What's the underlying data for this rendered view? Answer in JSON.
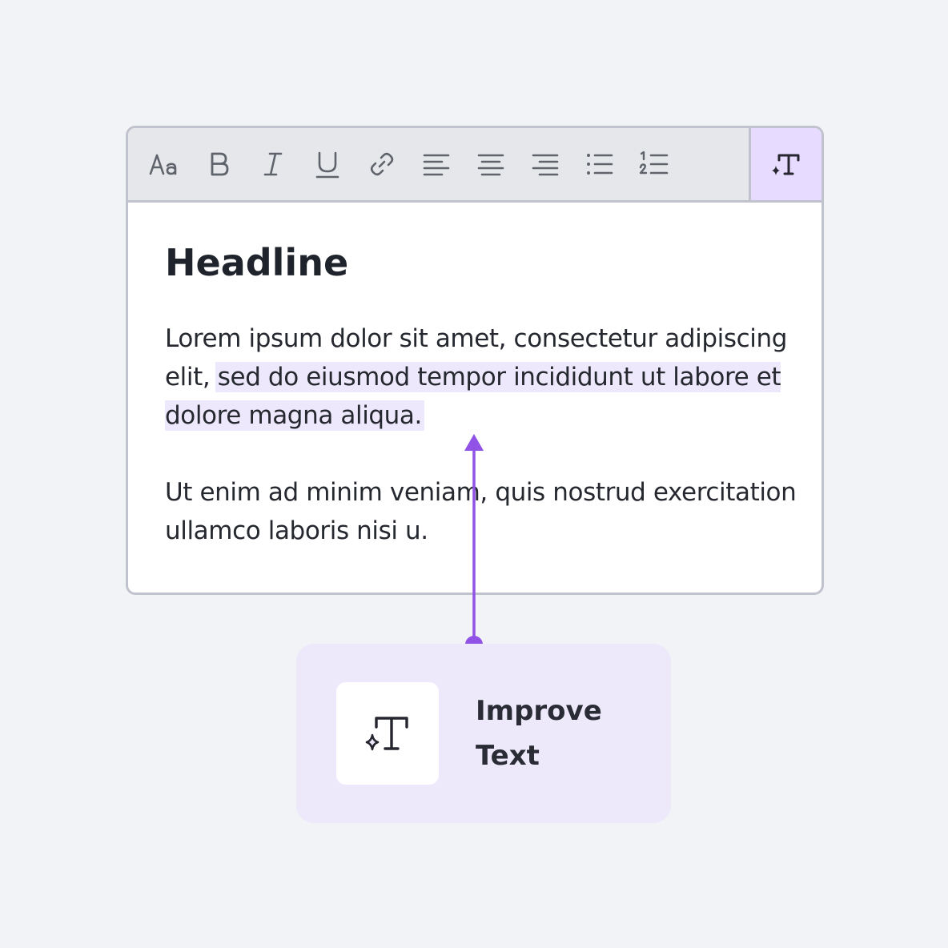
{
  "toolbar": {
    "buttons": [
      {
        "name": "font-size-icon",
        "label": "Aa"
      },
      {
        "name": "bold-icon",
        "label": "B"
      },
      {
        "name": "italic-icon",
        "label": "I"
      },
      {
        "name": "underline-icon",
        "label": "U"
      },
      {
        "name": "link-icon"
      },
      {
        "name": "align-left-icon"
      },
      {
        "name": "align-center-icon"
      },
      {
        "name": "align-right-icon"
      },
      {
        "name": "bullet-list-icon"
      },
      {
        "name": "numbered-list-icon"
      }
    ],
    "ai_button": {
      "name": "improve-text-icon",
      "active": true
    }
  },
  "document": {
    "headline": "Headline",
    "paragraph1_before": "Lorem ipsum dolor sit amet, consectetur adipiscing elit, ",
    "paragraph1_selected": "sed do eiusmod tempor incididunt ut labore et dolore magna aliqua.",
    "paragraph2": "Ut enim ad minim veniam, quis nostrud exercitation ullamco laboris nisi u."
  },
  "action_card": {
    "label_line1": "Improve",
    "label_line2": "Text"
  },
  "colors": {
    "accent": "#9153e6",
    "selection": "#ede8fb",
    "toolbar_bg": "#e6e7ea",
    "ai_button_bg": "#e7dcff",
    "card_bg": "#ede9fb"
  }
}
